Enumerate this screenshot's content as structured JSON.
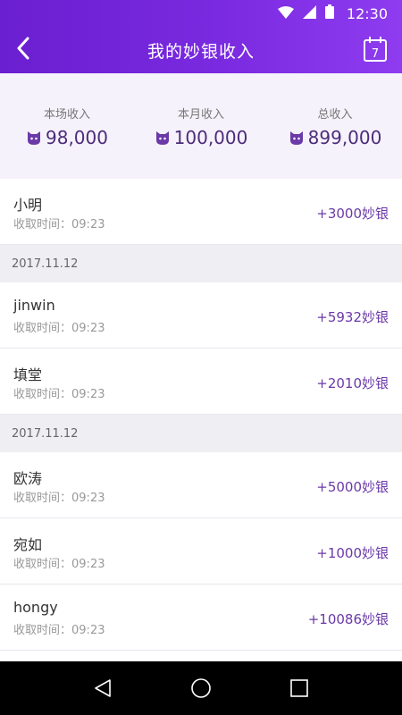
{
  "status": {
    "time": "12:30"
  },
  "nav": {
    "title": "我的妙银收入"
  },
  "calendar": {
    "day": "7"
  },
  "summary": [
    {
      "label": "本场收入",
      "value": "98,000"
    },
    {
      "label": "本月收入",
      "value": "100,000"
    },
    {
      "label": "总收入",
      "value": "899,000"
    }
  ],
  "list": {
    "time_prefix": "收取时间：",
    "groups": [
      {
        "date": "",
        "items": [
          {
            "name": "小明",
            "time": "09:23",
            "amount": "+3000妙银"
          }
        ]
      },
      {
        "date": "2017.11.12",
        "items": [
          {
            "name": "jinwin",
            "time": "09:23",
            "amount": "+5932妙银"
          },
          {
            "name": "填堂",
            "time": "09:23",
            "amount": "+2010妙银"
          }
        ]
      },
      {
        "date": "2017.11.12",
        "items": [
          {
            "name": "欧涛",
            "time": "09:23",
            "amount": "+5000妙银"
          },
          {
            "name": "宛如",
            "time": "09:23",
            "amount": "+1000妙银"
          },
          {
            "name": "hongy",
            "time": "09:23",
            "amount": "+10086妙银"
          }
        ]
      }
    ]
  },
  "colors": {
    "accent": "#7a2ae0",
    "amount": "#6b3aa8",
    "summary_value": "#4c2c7a"
  }
}
